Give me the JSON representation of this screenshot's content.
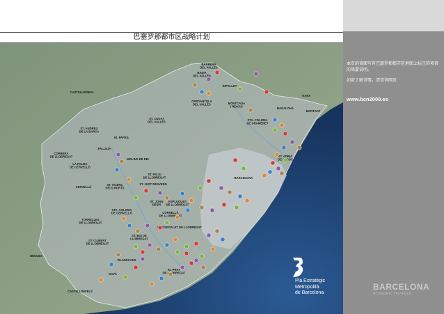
{
  "title": "巴塞罗那都市区战略计划",
  "panel": {
    "paragraph1": "本页的背面写有巴塞罗那都市区地图上标注的项目的简要说明。",
    "paragraph2": "如欲了解详情，请咨询网页",
    "url": "www.bcn2000.es"
  },
  "organization": {
    "line1": "Pla Estratègic",
    "line2": "Metropolità",
    "line3": "de Barcelona"
  },
  "brand": {
    "name": "BARCELONA",
    "tagline": "ECONOMIC TRIANGLE"
  },
  "colors": {
    "sea": "#1d3f6e",
    "land": "#8fa48c",
    "urban": "#b9c2c6",
    "panel": "#8f8f8f",
    "marker_blue": "#3f7fc4",
    "marker_orange": "#d98a3a",
    "marker_green": "#7cb342",
    "marker_red": "#d23b3b",
    "marker_purple": "#8e5aa8",
    "marker_brown": "#a9844f"
  },
  "places": [
    {
      "id": "barbera",
      "name": "BARBERÀ DEL VALLÈS",
      "lines": [
        "BARBERÀ",
        "DEL VALLÈS"
      ]
    },
    {
      "id": "badia",
      "name": "BADIA DEL VALLÈS",
      "lines": [
        "BADIA",
        "DEL VALLÈS"
      ]
    },
    {
      "id": "ripollet",
      "name": "RIPOLLET",
      "lines": [
        "RIPOLLET"
      ]
    },
    {
      "id": "castellbisbal",
      "name": "CASTELLBISBAL",
      "lines": [
        "CASTELLBISBAL"
      ]
    },
    {
      "id": "cerdanyola",
      "name": "CERDANYOLA DEL VALLÈS",
      "lines": [
        "CERDANYOLA",
        "DEL VALLÈS"
      ]
    },
    {
      "id": "montcada",
      "name": "MONTCADA I REIXAC",
      "lines": [
        "MONTCADA",
        "I REIXAC"
      ]
    },
    {
      "id": "tiana",
      "name": "TIANA",
      "lines": [
        "TIANA"
      ]
    },
    {
      "id": "badalona",
      "name": "BADALONA",
      "lines": [
        "BADALONA"
      ]
    },
    {
      "id": "montgat",
      "name": "MONTGAT",
      "lines": [
        "MONTGAT"
      ]
    },
    {
      "id": "santcugat",
      "name": "ST. CUGAT DEL VALLÈS",
      "lines": [
        "ST. CUGAT",
        "DEL VALLÈS"
      ]
    },
    {
      "id": "stacoloma_g",
      "name": "STA. COLOMA DE GRAMENET",
      "lines": [
        "STA. COLOMA",
        "DE GRAMENET"
      ]
    },
    {
      "id": "standreu",
      "name": "ST. ANDREU DE LA BARCA",
      "lines": [
        "ST. ANDREU",
        "DE LA BARCA"
      ]
    },
    {
      "id": "papiol",
      "name": "EL PAPIOL",
      "lines": [
        "EL PAPIOL"
      ]
    },
    {
      "id": "pallejà",
      "name": "PALLEJÀ",
      "lines": [
        "PALLEJÀ"
      ]
    },
    {
      "id": "corbera",
      "name": "CORBERA DE LLOBREGAT",
      "lines": [
        "CORBERA",
        "DE LLOBREGAT"
      ]
    },
    {
      "id": "molins",
      "name": "MOLINS DE REI",
      "lines": [
        "MOLINS DE REI"
      ]
    },
    {
      "id": "stadria",
      "name": "ST. ADRIÀ DE BESÒS",
      "lines": [
        "ST. ADRIÀ",
        "DE BESÒS"
      ]
    },
    {
      "id": "palma",
      "name": "LA PALMA DE CERVELLÓ",
      "lines": [
        "LA PALMA",
        "DE CERVELLÓ"
      ]
    },
    {
      "id": "stfeliu",
      "name": "ST. FELIU DE LLOBREGAT",
      "lines": [
        "ST. FELIU",
        "DE LLOBREGAT"
      ]
    },
    {
      "id": "cervello",
      "name": "CERVELLÓ",
      "lines": [
        "CERVELLÓ"
      ]
    },
    {
      "id": "stvicenc",
      "name": "ST. VICENÇ DELS HORTS",
      "lines": [
        "ST. VICENÇ",
        "DELS HORTS"
      ]
    },
    {
      "id": "stjustdesvern",
      "name": "ST. JUST DESVERN",
      "lines": [
        "ST. JUST DESVERN"
      ]
    },
    {
      "id": "barcelona",
      "name": "BARCELONA",
      "lines": [
        "BARCELONA"
      ]
    },
    {
      "id": "stjoan",
      "name": "ST. JOAN DESPÍ",
      "lines": [
        "ST. JOAN",
        "DESPÍ"
      ]
    },
    {
      "id": "esplugues",
      "name": "ESPLUGUES DE LLOBREGAT",
      "lines": [
        "ESPLUGUES",
        "DE LLOBREGAT"
      ]
    },
    {
      "id": "stacoloma_c",
      "name": "STA. COLOMA DE CERVELLÓ",
      "lines": [
        "STA. COLOMA",
        "DE CERVELLÓ"
      ]
    },
    {
      "id": "cornella",
      "name": "CORNELLÀ DE LLOBREGAT",
      "lines": [
        "CORNELLÀ",
        "DE LLOBREGAT"
      ]
    },
    {
      "id": "torrelles",
      "name": "TORRELLES DE LLOBREGAT",
      "lines": [
        "TORRELLES",
        "DE LLOBREGAT"
      ]
    },
    {
      "id": "hospitalet",
      "name": "L'HOSPITALET DE LLOBREGAT",
      "lines": [
        "L'HOSPITALET DE LLOBREGAT"
      ]
    },
    {
      "id": "stboi",
      "name": "ST. BOI DE LLOBREGAT",
      "lines": [
        "ST. BOI DE",
        "LLOBREGAT"
      ]
    },
    {
      "id": "stclimentt",
      "name": "ST. CLIMENT DE LLOBREGAT",
      "lines": [
        "ST. CLIMENT",
        "DE LLOBREGAT"
      ]
    },
    {
      "id": "begues",
      "name": "BEGUES",
      "lines": [
        "BEGUES"
      ]
    },
    {
      "id": "viladecans",
      "name": "VILADECANS",
      "lines": [
        "VILADECANS"
      ]
    },
    {
      "id": "elprat",
      "name": "EL PRAT DE LLOBREGAT",
      "lines": [
        "EL PRAT",
        "DE LLOBREGAT"
      ]
    },
    {
      "id": "gava",
      "name": "GAVÀ",
      "lines": [
        "GAVÀ"
      ]
    },
    {
      "id": "castelldefels",
      "name": "CASTELLDEFELS",
      "lines": [
        "CASTELLDEFELS"
      ]
    }
  ]
}
